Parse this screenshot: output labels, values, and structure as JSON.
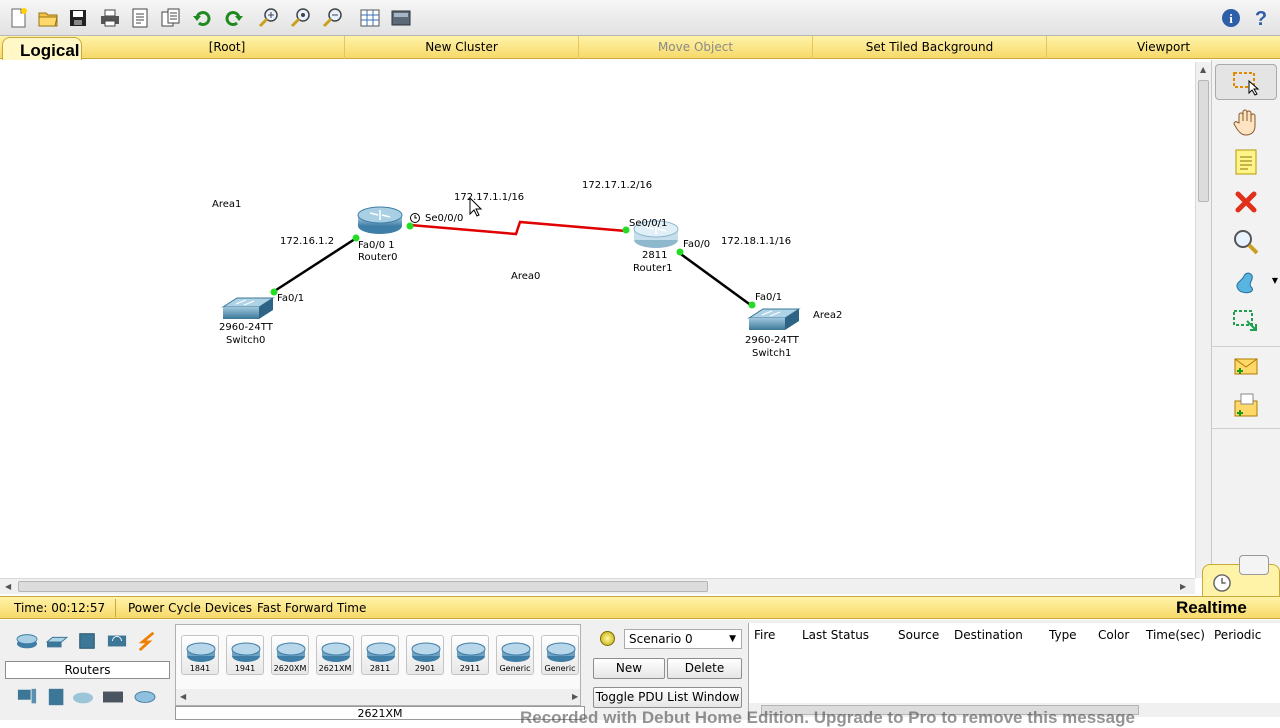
{
  "toolbar": {
    "buttons": [
      "new-file",
      "open-folder",
      "save",
      "print",
      "activity-wizard",
      "copy",
      "undo",
      "redo",
      "zoom-in",
      "zoom-reset",
      "zoom-out",
      "palette",
      "custom-device"
    ],
    "right": [
      "info",
      "help"
    ]
  },
  "nav": {
    "logical": "Logical",
    "root": "[Root]",
    "new_cluster": "New Cluster",
    "move_object": "Move Object",
    "set_tiled_background": "Set Tiled Background",
    "viewport": "Viewport"
  },
  "topology": {
    "area0": "Area0",
    "area1": "Area1",
    "area2": "Area2",
    "router0": {
      "name": "Router0",
      "fa": "Fa0/0 1",
      "se": "Se0/0/0"
    },
    "router1": {
      "model": "2811",
      "name": "Router1",
      "se": "Se0/0/1",
      "fa": "Fa0/0"
    },
    "switch0": {
      "model": "2960-24TT",
      "name": "Switch0",
      "port": "Fa0/1"
    },
    "switch1": {
      "model": "2960-24TT",
      "name": "Switch1",
      "port": "Fa0/1"
    },
    "ip_r0_lan": "172.16.1.2",
    "ip_r0_wan": "172.17.1.1/16",
    "ip_r1_wan": "172.17.1.2/16",
    "ip_r1_lan": "172.18.1.1/16",
    "colors": {
      "serial_link": "#e00000",
      "ethernet_link": "#000000",
      "link_up": "#22dd22"
    }
  },
  "status": {
    "time": "Time: 00:12:57",
    "power_cycle": "Power Cycle Devices",
    "fast_forward": "Fast Forward Time",
    "mode": "Realtime"
  },
  "devices": {
    "category": "Routers",
    "models": [
      "1841",
      "1941",
      "2620XM",
      "2621XM",
      "2811",
      "2901",
      "2911",
      "Generic",
      "Generic"
    ],
    "selected_model": "2621XM"
  },
  "scenario": {
    "selected": "Scenario 0",
    "new": "New",
    "delete": "Delete",
    "toggle": "Toggle PDU List Window"
  },
  "pdu_table": {
    "columns": [
      "Fire",
      "Last Status",
      "Source",
      "Destination",
      "Type",
      "Color",
      "Time(sec)",
      "Periodic"
    ]
  },
  "watermark": "Recorded with Debut Home Edition. Upgrade to Pro to remove this message"
}
